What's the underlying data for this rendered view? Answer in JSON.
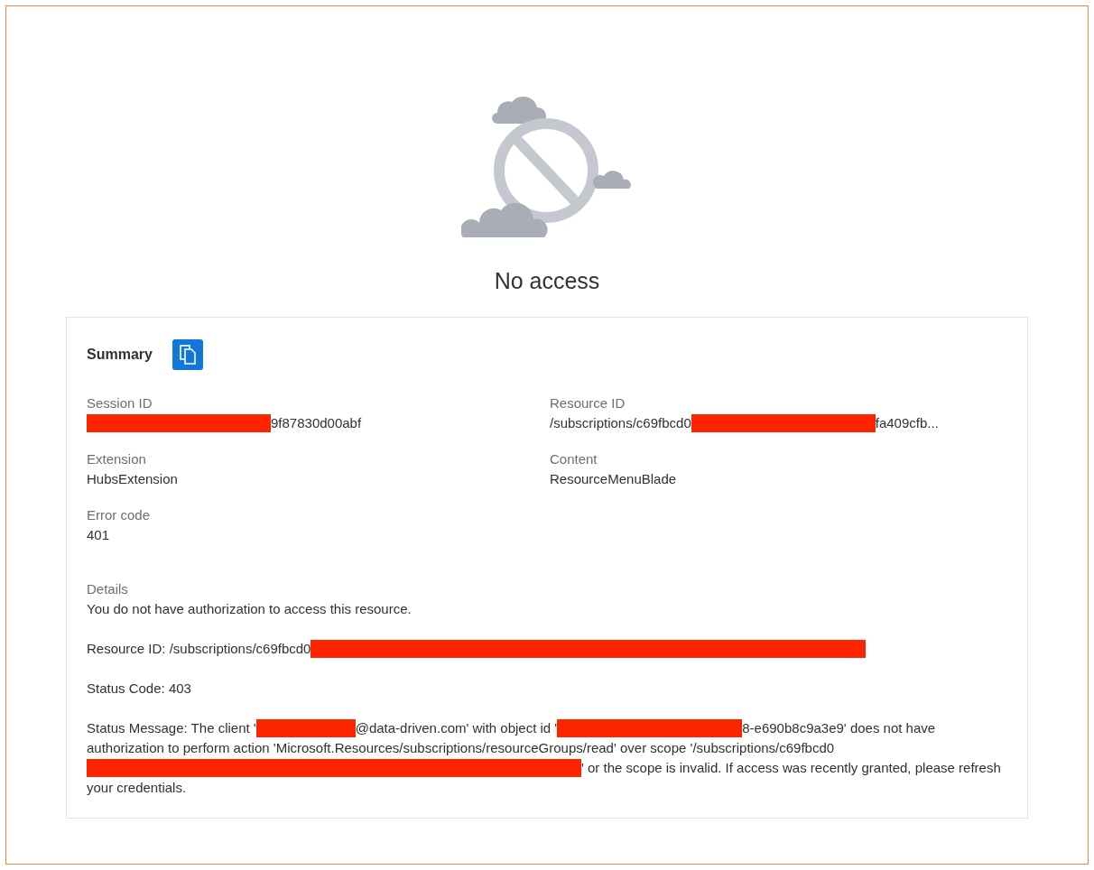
{
  "title": "No access",
  "summary": {
    "heading": "Summary",
    "fields": [
      {
        "label": "Session ID",
        "parts": [
          {
            "kind": "redacted"
          },
          {
            "kind": "text",
            "text": "9f87830d00abf"
          }
        ]
      },
      {
        "label": "Resource ID",
        "parts": [
          {
            "kind": "text",
            "text": "/subscriptions/c69fbcd0"
          },
          {
            "kind": "redacted"
          },
          {
            "kind": "text",
            "text": "fa409cfb..."
          }
        ]
      },
      {
        "label": "Extension",
        "parts": [
          {
            "kind": "text",
            "text": "HubsExtension"
          }
        ]
      },
      {
        "label": "Content",
        "parts": [
          {
            "kind": "text",
            "text": "ResourceMenuBlade"
          }
        ]
      },
      {
        "label": "Error code",
        "parts": [
          {
            "kind": "text",
            "text": "401"
          }
        ]
      }
    ],
    "details": {
      "label": "Details",
      "paragraphs": [
        [
          {
            "kind": "text",
            "text": "You do not have authorization to access this resource."
          }
        ],
        [
          {
            "kind": "text",
            "text": "Resource ID: /subscriptions/c69fbcd0"
          },
          {
            "kind": "redacted"
          }
        ],
        [
          {
            "kind": "text",
            "text": "Status Code: 403"
          }
        ],
        [
          {
            "kind": "text",
            "text": "Status Message: The client '"
          },
          {
            "kind": "redacted"
          },
          {
            "kind": "text",
            "text": "@data-driven.com' with object id '"
          },
          {
            "kind": "redacted"
          },
          {
            "kind": "text",
            "text": "8-e690b8c9a3e9' does not have authorization to perform action 'Microsoft.Resources/subscriptions/resourceGroups/read' over scope '/subscriptions/c69fbcd0"
          },
          {
            "kind": "redacted"
          },
          {
            "kind": "text",
            "text": "' or the scope is invalid. If access was recently granted, please refresh your credentials."
          }
        ]
      ]
    }
  }
}
